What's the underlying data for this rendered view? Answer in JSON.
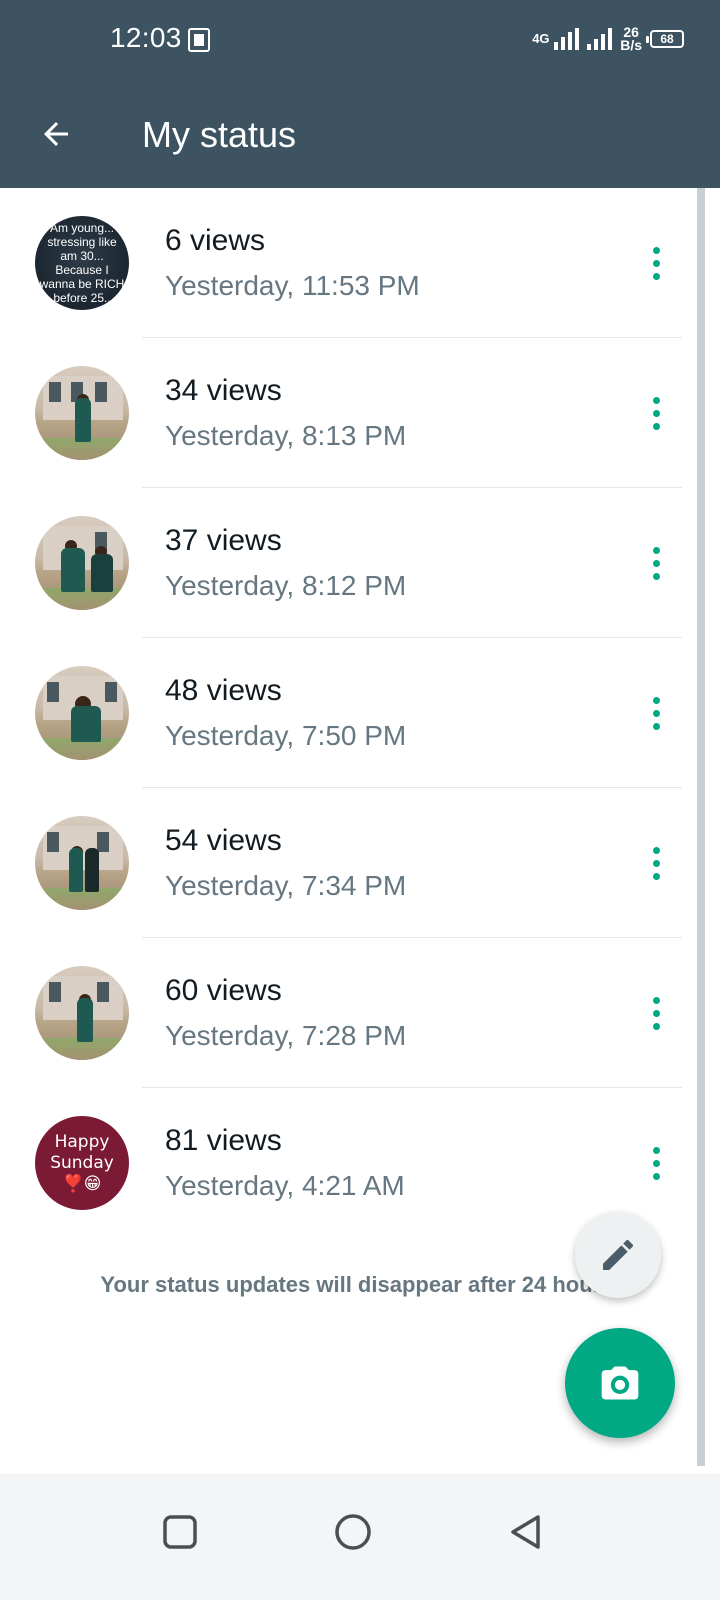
{
  "status_bar": {
    "time": "12:03",
    "network": "4G",
    "speed_value": "26",
    "speed_unit": "B/s",
    "battery": "68"
  },
  "app_bar": {
    "title": "My status",
    "back_icon": "arrow-back-icon"
  },
  "statuses": [
    {
      "views": "6 views",
      "time": "Yesterday, 11:53 PM",
      "thumb_text": "Am young... stressing like am 30... Because I wanna be RICH before 25.."
    },
    {
      "views": "34 views",
      "time": "Yesterday, 8:13 PM"
    },
    {
      "views": "37 views",
      "time": "Yesterday, 8:12 PM"
    },
    {
      "views": "48 views",
      "time": "Yesterday, 7:50 PM"
    },
    {
      "views": "54 views",
      "time": "Yesterday, 7:34 PM"
    },
    {
      "views": "60 views",
      "time": "Yesterday, 7:28 PM"
    },
    {
      "views": "81 views",
      "time": "Yesterday, 4:21 AM",
      "thumb_text": "Happy Sunday ❣️😁"
    }
  ],
  "footer_note": "Your status updates will disappear after 24 hours.",
  "fabs": {
    "pencil_icon": "pencil-icon",
    "camera_icon": "camera-icon"
  },
  "colors": {
    "app_bar": "#3d5361",
    "accent": "#00a884",
    "secondary_text": "#667781"
  },
  "nav": {
    "recents_icon": "square-icon",
    "home_icon": "circle-icon",
    "back_icon": "triangle-back-icon"
  }
}
